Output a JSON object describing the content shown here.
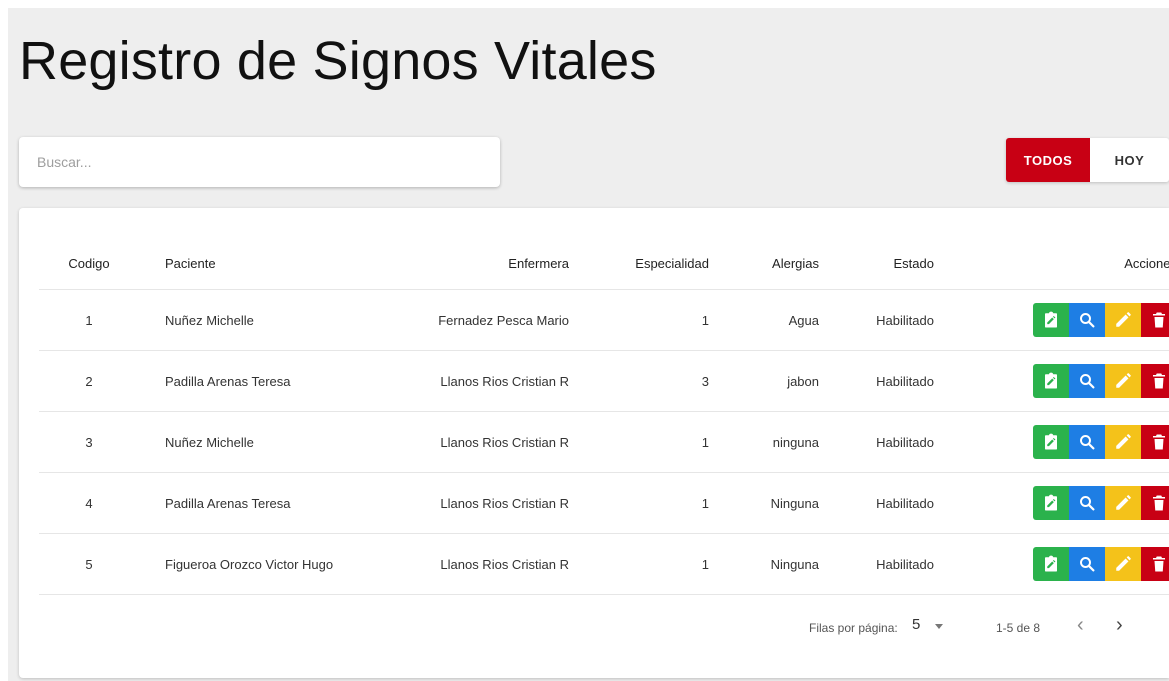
{
  "page": {
    "title": "Registro de Signos Vitales"
  },
  "search": {
    "placeholder": "Buscar..."
  },
  "filter": {
    "todos_label": "TODOS",
    "hoy_label": "HOY",
    "active": "TODOS",
    "active_color": "#c80014"
  },
  "table": {
    "headers": {
      "codigo": "Codigo",
      "paciente": "Paciente",
      "enfermera": "Enfermera",
      "especialidad": "Especialidad",
      "alergias": "Alergias",
      "estado": "Estado",
      "acciones": "Acciones"
    },
    "rows": [
      {
        "codigo": "1",
        "paciente": "Nuñez Michelle",
        "enfermera": "Fernadez Pesca Mario",
        "especialidad": "1",
        "alergias": "Agua",
        "estado": "Habilitado"
      },
      {
        "codigo": "2",
        "paciente": "Padilla Arenas Teresa",
        "enfermera": "Llanos Rios Cristian R",
        "especialidad": "3",
        "alergias": "jabon",
        "estado": "Habilitado"
      },
      {
        "codigo": "3",
        "paciente": "Nuñez Michelle",
        "enfermera": "Llanos Rios Cristian R",
        "especialidad": "1",
        "alergias": "ninguna",
        "estado": "Habilitado"
      },
      {
        "codigo": "4",
        "paciente": "Padilla Arenas Teresa",
        "enfermera": "Llanos Rios Cristian R",
        "especialidad": "1",
        "alergias": "Ninguna",
        "estado": "Habilitado"
      },
      {
        "codigo": "5",
        "paciente": "Figueroa Orozco Victor Hugo",
        "enfermera": "Llanos Rios Cristian R",
        "especialidad": "1",
        "alergias": "Ninguna",
        "estado": "Habilitado"
      }
    ],
    "action_icons": [
      {
        "name": "clipboard-edit-icon",
        "color": "#2bb24c"
      },
      {
        "name": "search-icon",
        "color": "#1e7ee4"
      },
      {
        "name": "pencil-icon",
        "color": "#f4c21a"
      },
      {
        "name": "trash-icon",
        "color": "#c80014"
      }
    ]
  },
  "pagination": {
    "rows_per_page_label": "Filas por página:",
    "rows_per_page_value": "5",
    "range_label": "1-5 de 8"
  }
}
